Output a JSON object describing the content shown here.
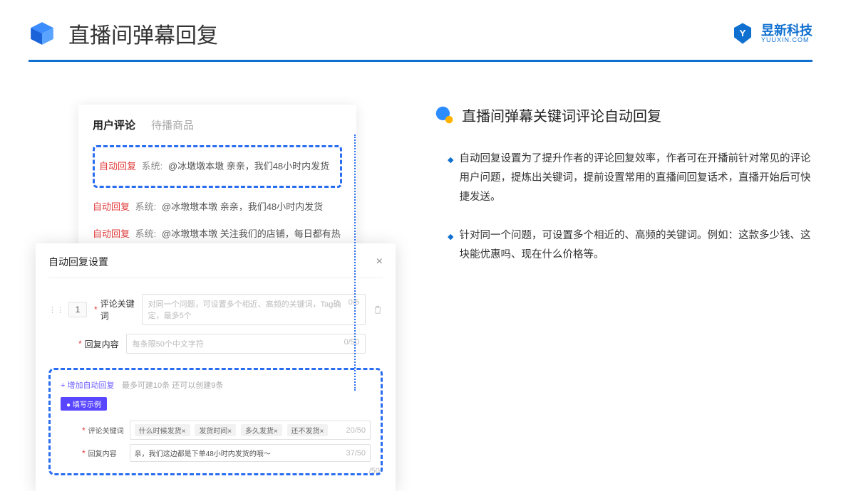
{
  "header": {
    "title": "直播间弹幕回复",
    "brand_cn": "昱新科技",
    "brand_en": "YUUXIN.COM"
  },
  "comment_panel": {
    "tabs": {
      "active": "用户评论",
      "inactive": "待播商品"
    },
    "rows": [
      {
        "auto": "自动回复",
        "sys": "系统:",
        "text": "@冰墩墩本墩 亲亲，我们48小时内发货"
      },
      {
        "auto": "自动回复",
        "sys": "系统:",
        "text": "@冰墩墩本墩 亲亲，我们48小时内发货"
      },
      {
        "auto": "自动回复",
        "sys": "系统:",
        "text": "@冰墩墩本墩 关注我们的店铺，每日都有热门推荐呦～"
      }
    ]
  },
  "settings": {
    "title": "自动回复设置",
    "row_num": "1",
    "labels": {
      "keyword": "评论关键词",
      "content": "回复内容"
    },
    "placeholders": {
      "keyword": "对同一个问题，可设置多个相近、高频的关键词，Tag确定，最多5个",
      "content": "每条限50个中文字符"
    },
    "counters": {
      "keyword": "0/5",
      "content": "0/50"
    },
    "add_link": "+ 增加自动回复",
    "add_hint": "最多可建10条 还可以创建9条",
    "example_pill": "● 填写示例",
    "example": {
      "kw_label": "评论关键词",
      "kw_tags": [
        "什么时候发货×",
        "发货时间×",
        "多久发货×",
        "还不发货×"
      ],
      "kw_counter": "20/50",
      "ct_label": "回复内容",
      "ct_value": "亲，我们这边都是下单48小时内发货的哦～",
      "ct_counter": "37/50"
    },
    "extra_counter": "/50"
  },
  "right": {
    "section_title": "直播间弹幕关键词评论自动回复",
    "bullets": [
      "自动回复设置为了提升作者的评论回复效率，作者可在开播前针对常见的评论用户问题，提炼出关键词，提前设置常用的直播间回复话术，直播开始后可快捷发送。",
      "针对同一个问题，可设置多个相近的、高频的关键词。例如：这款多少钱、这块能优惠吗、现在什么价格等。"
    ]
  }
}
